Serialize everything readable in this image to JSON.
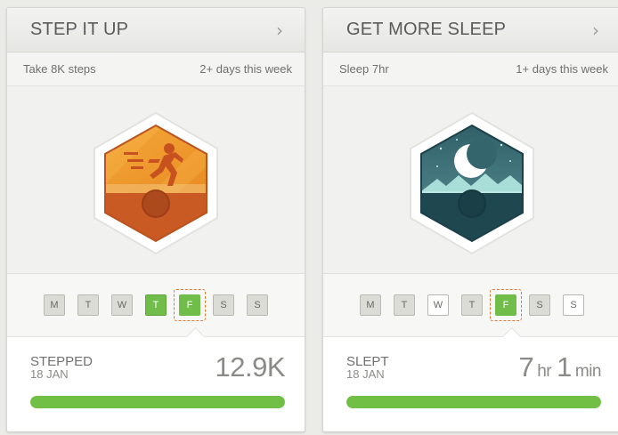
{
  "cards": [
    {
      "title": "STEP IT UP",
      "chevron": "›",
      "goal": "Take 8K steps",
      "target": "2+ days this week",
      "badge": {
        "icon": "running-person-icon",
        "top_color": "#f09a2d",
        "bottom_color": "#c95a24"
      },
      "days": [
        {
          "label": "M",
          "state": "default"
        },
        {
          "label": "T",
          "state": "default"
        },
        {
          "label": "W",
          "state": "default"
        },
        {
          "label": "T",
          "state": "done"
        },
        {
          "label": "F",
          "state": "today"
        },
        {
          "label": "S",
          "state": "default"
        },
        {
          "label": "S",
          "state": "default"
        }
      ],
      "stat_label": "STEPPED",
      "stat_date": "18 JAN",
      "stat_value": "12.9K",
      "progress": 1.0
    },
    {
      "title": "GET MORE SLEEP",
      "chevron": "›",
      "goal": "Sleep 7hr",
      "target": "1+ days this week",
      "badge": {
        "icon": "moon-icon",
        "top_color": "#3d6b73",
        "bottom_color": "#1f4750"
      },
      "days": [
        {
          "label": "M",
          "state": "default"
        },
        {
          "label": "T",
          "state": "default"
        },
        {
          "label": "W",
          "state": "white"
        },
        {
          "label": "T",
          "state": "default"
        },
        {
          "label": "F",
          "state": "today"
        },
        {
          "label": "S",
          "state": "default"
        },
        {
          "label": "S",
          "state": "white"
        }
      ],
      "stat_label": "SLEPT",
      "stat_date": "18 JAN",
      "stat_value_hours": "7",
      "stat_unit_hours": "hr",
      "stat_value_minutes": "1",
      "stat_unit_minutes": "min",
      "progress": 1.0
    }
  ],
  "colors": {
    "accent_green": "#72bf46",
    "today_outline": "#e07a33"
  }
}
